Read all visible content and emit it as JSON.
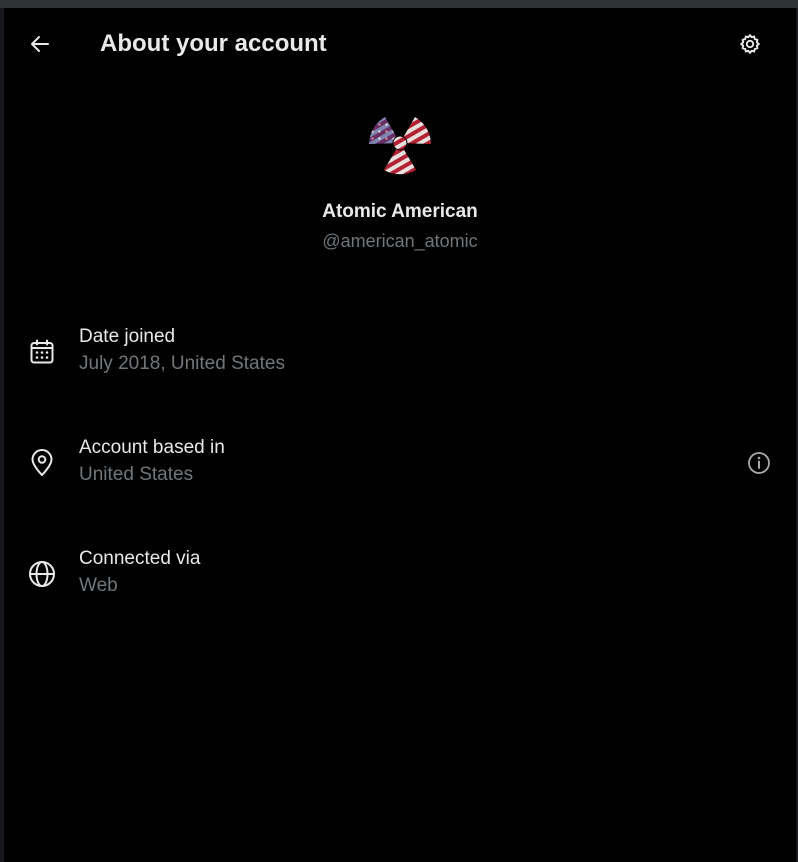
{
  "header": {
    "title": "About your account",
    "back_icon": "arrow-left-icon",
    "settings_icon": "gear-icon"
  },
  "profile": {
    "display_name": "Atomic American",
    "handle": "@american_atomic",
    "avatar_icon": "radiation-flag-avatar"
  },
  "details": [
    {
      "icon": "calendar-icon",
      "label": "Date joined",
      "value": "July 2018, United States"
    },
    {
      "icon": "location-pin-icon",
      "label": "Account based in",
      "value": "United States",
      "action_icon": "info-icon"
    },
    {
      "icon": "globe-icon",
      "label": "Connected via",
      "value": "Web"
    }
  ],
  "colors": {
    "background": "#000000",
    "primary_text": "#e7e9ea",
    "secondary_text": "#71767b",
    "frame": "#2f3336"
  }
}
